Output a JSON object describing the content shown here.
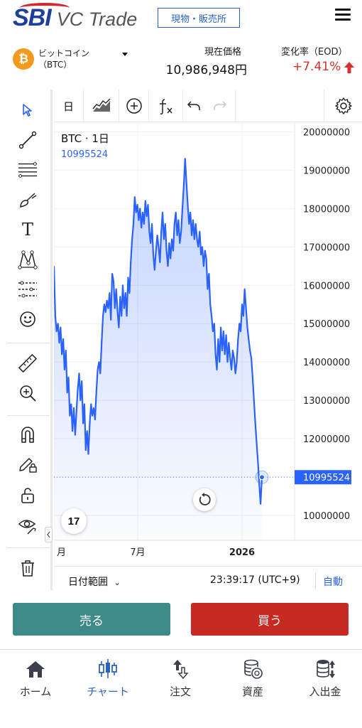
{
  "header": {
    "logo_sbi": "SBI",
    "logo_vc": "VC Trade",
    "exchange_button": "現物・販売所"
  },
  "ticker": {
    "coin_symbol_icon": "₿",
    "coin_name": "ビットコイン",
    "coin_code": "（BTC）",
    "price_label": "現在価格",
    "price_value": "10,986,948円",
    "change_label": "変化率（EOD）",
    "change_value": "+7.41%"
  },
  "chart_toolbar": {
    "interval": "日"
  },
  "chart": {
    "symbol_label": "BTC · 1日",
    "last_value_label": "10995524",
    "tv_logo": "17"
  },
  "chart_data": {
    "type": "area",
    "title": "BTC · 1日",
    "y_ticks": [
      "20000000",
      "19000000",
      "18000000",
      "17000000",
      "16000000",
      "15000000",
      "14000000",
      "13000000",
      "12000000",
      "11000000",
      "10000000"
    ],
    "x_ticks": [
      "月",
      "7月",
      "2026"
    ],
    "ylim": [
      9350000,
      20250000
    ],
    "last_value": 10995524,
    "series": [
      {
        "values": [
          16500000,
          15200000,
          14800000,
          15000000,
          14500000,
          14900000,
          14200000,
          14600000,
          13800000,
          14300000,
          13200000,
          13600000,
          12600000,
          12900000,
          12200000,
          12800000,
          12100000,
          12700000,
          13300000,
          13700000,
          13000000,
          13500000,
          12400000,
          12900000,
          11700000,
          12200000,
          11600000,
          12400000,
          12900000,
          12600000,
          12800000,
          12500000,
          13200000,
          13800000,
          14000000,
          13700000,
          14500000,
          15200000,
          15500000,
          15300000,
          15600000,
          15400000,
          15800000,
          15100000,
          16300000,
          16100000,
          15400000,
          15900000,
          15300000,
          14900000,
          15700000,
          15200000,
          16000000,
          15400000,
          15800000,
          15200000,
          16200000,
          15800000,
          16600000,
          17200000,
          17600000,
          18300000,
          17900000,
          18100000,
          17700000,
          18000000,
          17500000,
          17900000,
          17600000,
          18200000,
          17800000,
          18100000,
          17400000,
          17100000,
          17600000,
          16800000,
          16400000,
          16900000,
          17300000,
          17000000,
          16600000,
          17400000,
          17900000,
          17200000,
          17600000,
          16900000,
          16500000,
          17100000,
          16700000,
          17200000,
          16900000,
          17600000,
          17900000,
          17300000,
          17700000,
          17100000,
          17400000,
          18000000,
          18600000,
          19300000,
          18700000,
          18100000,
          17600000,
          17900000,
          17300000,
          17700000,
          17200000,
          17600000,
          17200000,
          17000000,
          17400000,
          16800000,
          17000000,
          16500000,
          16900000,
          16700000,
          15900000,
          16300000,
          15500000,
          15200000,
          14800000,
          15000000,
          14200000,
          13800000,
          14600000,
          14000000,
          14900000,
          14300000,
          14800000,
          14200000,
          14700000,
          14000000,
          14500000,
          14100000,
          13800000,
          14300000,
          14100000,
          13700000,
          14000000,
          14600000,
          15000000,
          14800000,
          15500000,
          15200000,
          15900000,
          15400000,
          14900000,
          14600000,
          14300000,
          14100000,
          13600000,
          13000000,
          12400000,
          11900000,
          11400000,
          10800000,
          10300000,
          10995524
        ]
      }
    ]
  },
  "left_tools": [
    {
      "icon": "cursor-arrow-icon"
    },
    {
      "icon": "trend-line-icon"
    },
    {
      "icon": "fib-lines-icon"
    },
    {
      "icon": "brush-icon"
    },
    {
      "icon": "text-icon",
      "text": "T"
    },
    {
      "icon": "pattern-icon"
    },
    {
      "icon": "forecast-icon"
    },
    {
      "icon": "emoji-icon"
    },
    {
      "icon": "ruler-icon"
    },
    {
      "icon": "zoom-in-icon"
    },
    {
      "icon": "magnet-icon"
    },
    {
      "icon": "lock-drawing-icon"
    },
    {
      "icon": "lock-icon"
    },
    {
      "icon": "eye-icon"
    },
    {
      "icon": "trash-icon"
    }
  ],
  "range_bar": {
    "date_range_label": "日付範囲",
    "time": "23:39:17 (UTC+9)",
    "auto": "自動"
  },
  "actions": {
    "sell": "売る",
    "buy": "買う"
  },
  "nav": {
    "items": [
      {
        "label": "ホーム",
        "icon": "home-icon"
      },
      {
        "label": "チャート",
        "icon": "candlestick-icon"
      },
      {
        "label": "注文",
        "icon": "order-arrows-icon"
      },
      {
        "label": "資産",
        "icon": "coins-icon"
      },
      {
        "label": "入出金",
        "icon": "deposit-icon"
      }
    ]
  },
  "colors": {
    "brand": "#1d3f9a",
    "accent": "#2962ff",
    "sell": "#3d8a89",
    "buy": "#c62a23",
    "change_positive": "#d9302c",
    "coin": "#f39a1e"
  }
}
